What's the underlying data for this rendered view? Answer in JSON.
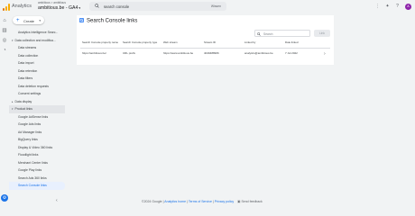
{
  "header": {
    "app_name": "Analytics",
    "account_path": "ambitious > ambitious",
    "property_name": "ambitious.be - GA4",
    "property_caret": "▾",
    "search": {
      "value": "search console",
      "clear_label": "Wissen"
    },
    "avatar_initial": "A",
    "icons": [
      "apps-icon",
      "insights-icon",
      "help-icon",
      "avatar"
    ]
  },
  "create_button": {
    "label": "Create",
    "dropdown": "▾"
  },
  "nav": {
    "items": [
      {
        "label": "Analytics Intelligence Searc...",
        "level": 1
      },
      {
        "label": "Data collection and modifica...",
        "level": 0,
        "expanded": true
      },
      {
        "label": "Data streams",
        "level": 1
      },
      {
        "label": "Data collection",
        "level": 1
      },
      {
        "label": "Data import",
        "level": 1
      },
      {
        "label": "Data retention",
        "level": 1
      },
      {
        "label": "Data filters",
        "level": 1
      },
      {
        "label": "Data deletion requests",
        "level": 1
      },
      {
        "label": "Consent settings",
        "level": 1
      },
      {
        "label": "Data display",
        "level": 0,
        "expanded": false
      },
      {
        "label": "Product links",
        "level": 0,
        "expanded": true,
        "group": true
      },
      {
        "label": "Google AdSense links",
        "level": 1
      },
      {
        "label": "Google Ads links",
        "level": 1
      },
      {
        "label": "Ad Manager links",
        "level": 1
      },
      {
        "label": "BigQuery links",
        "level": 1
      },
      {
        "label": "Display & Video 360 links",
        "level": 1
      },
      {
        "label": "Floodlight links",
        "level": 1
      },
      {
        "label": "Merchant Center links",
        "level": 1
      },
      {
        "label": "Google Play links",
        "level": 1
      },
      {
        "label": "Search Ads 360 links",
        "level": 1
      },
      {
        "label": "Search Console links",
        "level": 1,
        "active": true
      }
    ],
    "collapse_glyph": "‹"
  },
  "main": {
    "title": "Search Console links",
    "table_search_placeholder": "Search",
    "link_button": "Link",
    "columns": [
      "Search Console property name",
      "Search Console property type",
      "Web stream",
      "Stream ID",
      "Linked by",
      "Date linked"
    ],
    "rows": [
      {
        "property_name": "https://ambitious.be/",
        "property_type": "URL prefix",
        "web_stream": "https://www.ambitious.be",
        "stream_id": "4049488966",
        "linked_by": "analytics@ambitious.be",
        "date_linked": "7 Jul 2022"
      }
    ]
  },
  "footer": {
    "copyright": "©2024 Google",
    "home": "Analytics home",
    "terms": "Terms of Service",
    "privacy": "Privacy policy",
    "sep": " | ",
    "feedback": "Send feedback"
  },
  "colors": {
    "accent": "#1a73e8",
    "background": "#f1f3f4",
    "card": "#ffffff",
    "active_nav": "#e8f0fe"
  }
}
